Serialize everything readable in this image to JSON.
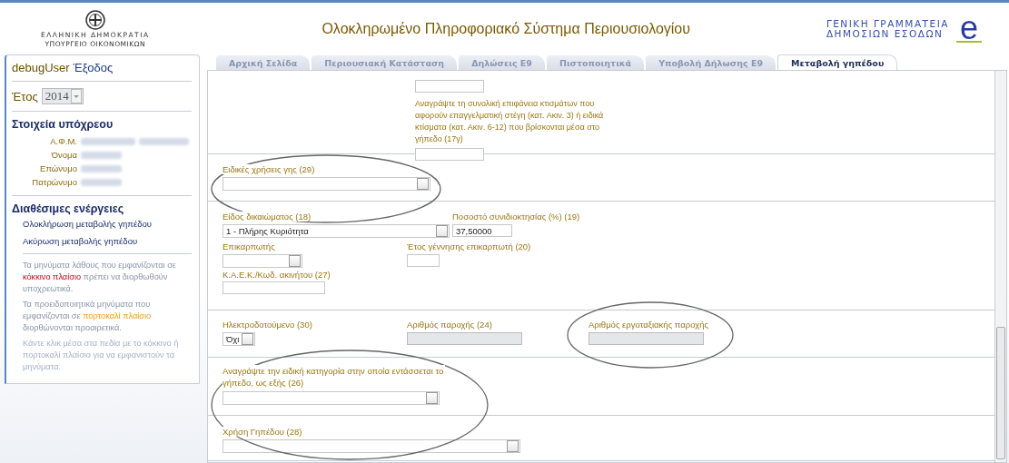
{
  "header": {
    "emblem_lines": [
      "ΕΛΛΗΝΙΚΗ ΔΗΜΟΚΡΑΤΙΑ",
      "ΥΠΟΥΡΓΕΙΟ ΟΙΚΟΝΟΜΙΚΩΝ"
    ],
    "title": "Ολοκληρωμένο Πληροφοριακό Σύστημα Περιουσιολογίου",
    "agency_lines": [
      "ΓΕΝΙΚΗ ΓΡΑΜΜΑΤΕΙΑ",
      "ΔΗΜΟΣΙΩΝ ΕΣΟΔΩΝ"
    ],
    "agency_logo": "e"
  },
  "sidebar": {
    "user": "debugUser",
    "logout": "Έξοδος",
    "year_label": "Έτος",
    "year": {
      "value": "2014",
      "disabled": true
    },
    "taxpayer_heading": "Στοιχεία υπόχρεου",
    "taxpayer_fields": [
      {
        "label": "Α.Φ.Μ.",
        "redacted": true
      },
      {
        "label": "Όνομα",
        "redacted": true
      },
      {
        "label": "Επώνυμο",
        "redacted": true
      },
      {
        "label": "Πατρώνυμο",
        "redacted": true
      }
    ],
    "actions_heading": "Διαθέσιμες ενέργειες",
    "actions": [
      "Ολοκλήρωση μεταβολής γηπέδου",
      "Ακύρωση μεταβολής γηπέδου"
    ],
    "notes": [
      [
        {
          "text": "Τα μηνύματα λάθους που εμφανίζονται σε ",
          "kind": "plain"
        },
        {
          "text": "κόκκινο πλαίσιο",
          "kind": "error"
        },
        {
          "text": " πρέπει να διορθωθούν υποχρεωτικά.",
          "kind": "plain"
        }
      ],
      [
        {
          "text": "Τα προειδοποιητικά μηνύματα που εμφανίζονται σε ",
          "kind": "plain"
        },
        {
          "text": "πορτοκαλί πλαίσιο",
          "kind": "warning"
        },
        {
          "text": " διορθώνονται προαιρετικά.",
          "kind": "plain"
        }
      ],
      [
        {
          "text": "Κάντε κλικ μέσα στα πεδία με το κόκκινο ή πορτοκαλί πλαίσιο για να εμφανιστούν τα μηνύματα.",
          "kind": "hint"
        }
      ]
    ]
  },
  "tabs": [
    {
      "label": "Αρχική Σελίδα",
      "selected": false
    },
    {
      "label": "Περιουσιακή Κατάσταση",
      "selected": false
    },
    {
      "label": "Δηλώσεις Ε9",
      "selected": false
    },
    {
      "label": "Πιστοποιητικά",
      "selected": false
    },
    {
      "label": "Υποβολή Δήλωσης Ε9",
      "selected": false
    },
    {
      "label": "Μεταβολή γηπέδου",
      "selected": true
    }
  ],
  "form": {
    "built_area_paragraph": "Αναγράψτε τη συνολική επιφάνεια κτισμάτων που αφορούν επαγγελματική στέγη (κατ. Ακιν. 3) ή ειδικά κτίσματα (κατ. Ακιν. 6-12) που βρίσκονται μέσα στο γήπεδο (17γ)",
    "special_land_use": {
      "label": "Ειδικές χρήσεις γης (29)"
    },
    "right_type": {
      "label": "Είδος δικαιώματος (18)",
      "value": "1 - Πλήρης Κυριότητα"
    },
    "co_ownership": {
      "label": "Ποσοστό συνιδιοκτησίας (%) (19)",
      "value": "37,50000"
    },
    "usufructuary": {
      "label": "Επικαρπωτής"
    },
    "usufructuary_birth_year": {
      "label": "Έτος γέννησης επικαρπωτή (20)"
    },
    "kaek": {
      "label": "Κ.Α.Ε.Κ./Κωδ. ακινήτου (27)"
    },
    "electrified": {
      "label": "Ηλεκτροδοτούμενο (30)",
      "value": "Όχι"
    },
    "supply_number": {
      "label": "Αριθμός παροχής (24)",
      "disabled": true
    },
    "construction_supply_number": {
      "label": "Αριθμός εργοταξιακής παροχής",
      "disabled": true
    },
    "special_category": {
      "label": "Αναγράψτε την ειδική κατηγορία στην οποία εντάσσεται το γήπεδο, ως εξής (26)"
    },
    "land_use": {
      "label": "Χρήση Γηπέδου (28)"
    }
  }
}
